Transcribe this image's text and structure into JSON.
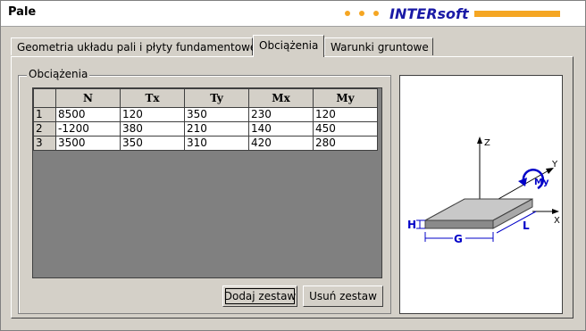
{
  "window": {
    "title": "Pale",
    "brand": "INTERsoft",
    "brand_color": "#1a1aa6",
    "accent_color": "#f5a623"
  },
  "tabs": [
    {
      "label": "Geometria układu pali i płyty fundamentowej",
      "active": false
    },
    {
      "label": "Obciążenia",
      "active": true
    },
    {
      "label": "Warunki gruntowe",
      "active": false
    }
  ],
  "loads": {
    "legend": "Obciążenia",
    "columns": [
      "N",
      "Tx",
      "Ty",
      "Mx",
      "My"
    ],
    "rows": [
      {
        "index": "1",
        "values": [
          "8500",
          "120",
          "350",
          "230",
          "120"
        ]
      },
      {
        "index": "2",
        "values": [
          "-1200",
          "380",
          "210",
          "140",
          "450"
        ]
      },
      {
        "index": "3",
        "values": [
          "3500",
          "350",
          "310",
          "420",
          "280"
        ]
      }
    ],
    "add_button": "Dodaj zestaw",
    "remove_button": "Usuń zestaw"
  },
  "diagram": {
    "axis_z": "Z",
    "axis_y": "Y",
    "axis_x": "X",
    "moment": "My",
    "dim_h": "H",
    "dim_g": "G",
    "dim_l": "L"
  }
}
